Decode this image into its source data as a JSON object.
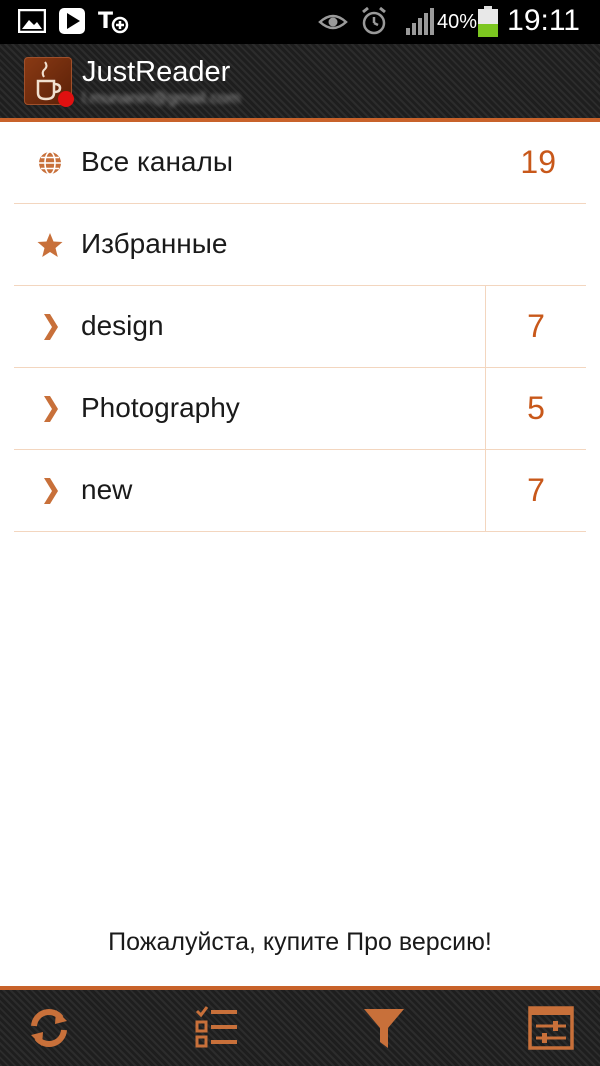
{
  "status_bar": {
    "time": "19:11",
    "battery_percent": "40%",
    "icons": [
      "gallery-icon",
      "play-store-icon",
      "tasks-icon",
      "eye-icon",
      "alarm-icon",
      "signal-icon",
      "battery-icon"
    ]
  },
  "app_bar": {
    "title": "JustReader",
    "account": "l.munanin@gmail.com"
  },
  "feeds": [
    {
      "label": "Все каналы",
      "count": "19",
      "icon": "globe-icon"
    },
    {
      "label": "Избранные",
      "count": "",
      "icon": "star-icon"
    },
    {
      "label": "design",
      "count": "7",
      "icon": "chevron-right-icon"
    },
    {
      "label": "Photography",
      "count": "5",
      "icon": "chevron-right-icon"
    },
    {
      "label": "new",
      "count": "7",
      "icon": "chevron-right-icon"
    }
  ],
  "promo_text": "Пожалуйста, купите Про версию!",
  "bottom_bar": {
    "icons": [
      "refresh-icon",
      "checklist-icon",
      "filter-icon",
      "settings-panel-icon"
    ]
  },
  "colors": {
    "accent": "#c8622a",
    "count_text": "#c8581a",
    "divider": "#f3d6bf",
    "icon_fill": "#c8703a"
  }
}
